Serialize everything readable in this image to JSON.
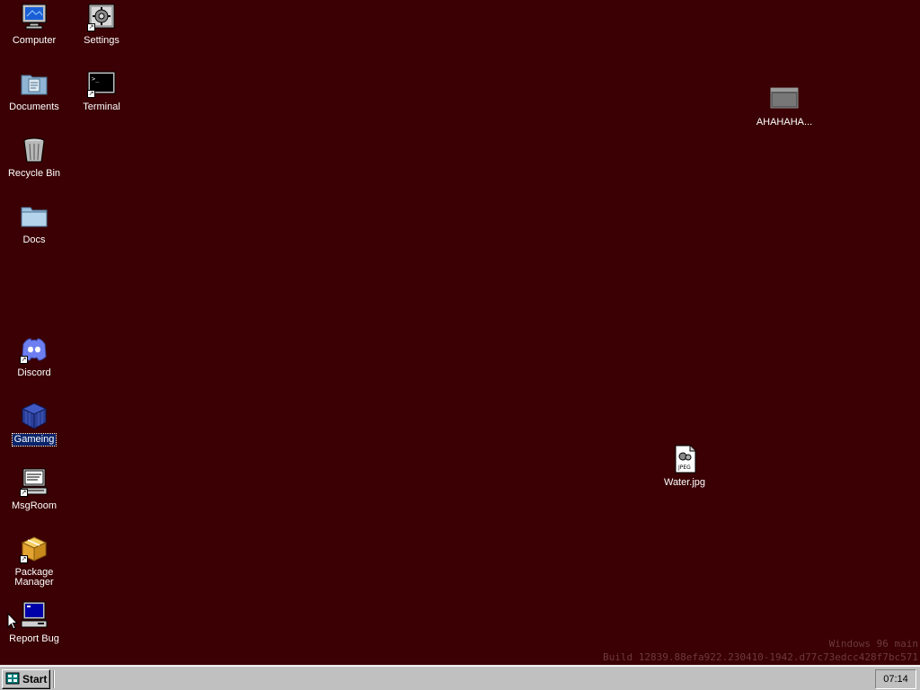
{
  "desktop": {
    "background_color": "#3a0003",
    "icons": {
      "computer": {
        "label": "Computer",
        "icon": "computer-monitor-icon"
      },
      "settings": {
        "label": "Settings",
        "icon": "gears-icon"
      },
      "documents": {
        "label": "Documents",
        "icon": "documents-folder-icon"
      },
      "terminal": {
        "label": "Terminal",
        "icon": "terminal-icon"
      },
      "recycle_bin": {
        "label": "Recycle Bin",
        "icon": "recycle-bin-icon"
      },
      "docs": {
        "label": "Docs",
        "icon": "folder-icon"
      },
      "discord": {
        "label": "Discord",
        "icon": "discord-icon"
      },
      "gameing": {
        "label": "Gameing",
        "icon": "blue-cube-icon",
        "selected": true
      },
      "msgroom": {
        "label": "MsgRoom",
        "icon": "msgroom-computer-icon"
      },
      "package_manager": {
        "label": "Package Manager",
        "icon": "package-box-icon"
      },
      "report_bug": {
        "label": "Report Bug",
        "icon": "bug-report-computer-icon"
      },
      "ahahaha": {
        "label": "AHAHAHA...",
        "icon": "window-app-icon"
      },
      "water": {
        "label": "Water.jpg",
        "icon": "jpeg-file-icon"
      }
    }
  },
  "watermark": {
    "line1": "Windows 96 main",
    "line2": "Build 12839.88efa922.230410-1942.d77c73edcc428f7bc571"
  },
  "taskbar": {
    "start_label": "Start",
    "clock": "07:14"
  }
}
